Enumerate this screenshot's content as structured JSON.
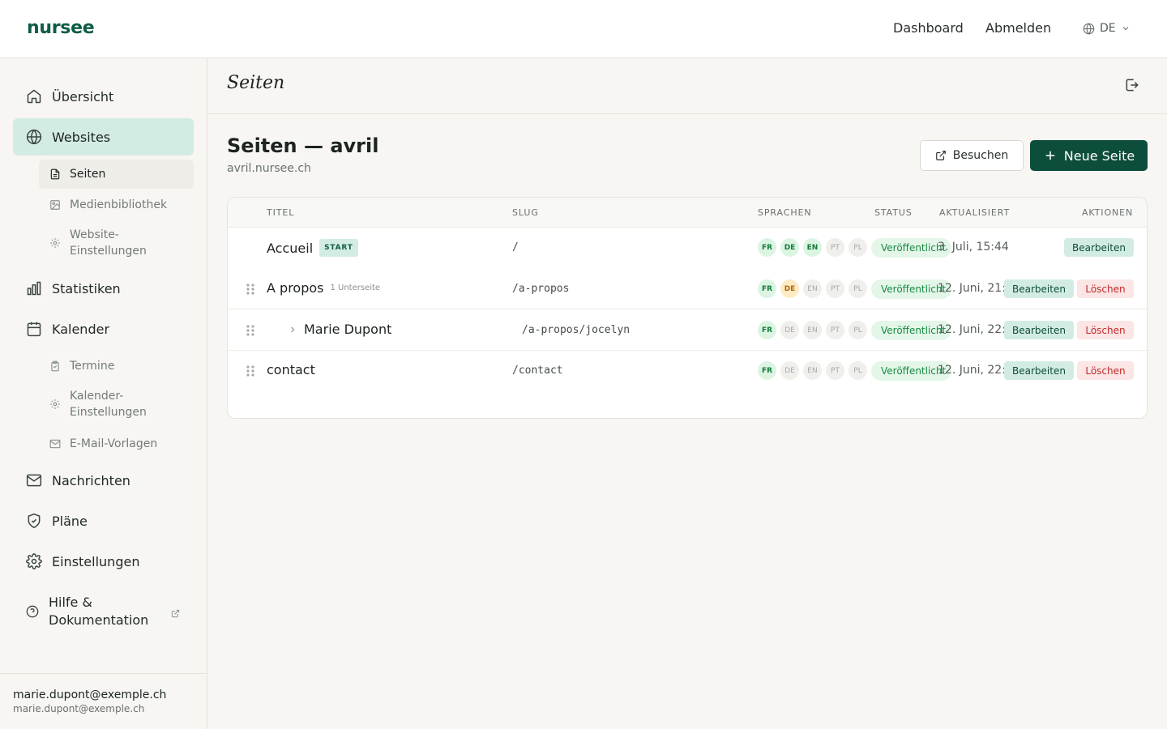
{
  "app": {
    "logo": "nursee"
  },
  "topnav": {
    "dashboard": "Dashboard",
    "logout": "Abmelden",
    "language": "DE"
  },
  "sidebar": {
    "items": [
      {
        "label": "Übersicht",
        "icon": "home-icon"
      },
      {
        "label": "Websites",
        "icon": "globe-icon",
        "active": true
      },
      {
        "label": "Statistiken",
        "icon": "bar-chart-icon"
      },
      {
        "label": "Kalender",
        "icon": "calendar-icon"
      },
      {
        "label": "Nachrichten",
        "icon": "mail-icon"
      },
      {
        "label": "Pläne",
        "icon": "shield-check-icon"
      },
      {
        "label": "Einstellungen",
        "icon": "gear-icon"
      },
      {
        "label": "Hilfe & Dokumentation",
        "icon": "help-circle-icon"
      }
    ],
    "website_sub": [
      {
        "label": "Seiten",
        "icon": "document-icon",
        "active": true
      },
      {
        "label": "Medienbibliothek",
        "icon": "image-icon"
      },
      {
        "label": "Website-Einstellungen",
        "icon": "gear-icon"
      }
    ],
    "calendar_sub": [
      {
        "label": "Termine",
        "icon": "clipboard-icon"
      },
      {
        "label": "Kalender-Einstellungen",
        "icon": "gear-icon"
      },
      {
        "label": "E-Mail-Vorlagen",
        "icon": "mail-icon"
      }
    ],
    "help_line1": "Hilfe &",
    "help_line2": "Dokumentation",
    "website_settings_line1": "Website-",
    "website_settings_line2": "Einstellungen",
    "calendar_settings_line1": "Kalender-",
    "calendar_settings_line2": "Einstellungen",
    "user_name": "marie.dupont@exemple.ch",
    "user_email": "marie.dupont@exemple.ch"
  },
  "page": {
    "header_title": "Seiten",
    "heading": "Seiten — avril",
    "domain": "avril.nursee.ch",
    "visit_button": "Besuchen",
    "new_page_button": "Neue Seite"
  },
  "table": {
    "columns": [
      "TITEL",
      "SLUG",
      "SPRACHEN",
      "STATUS",
      "AKTUALISIERT",
      "AKTIONEN"
    ],
    "rows": [
      {
        "title": "Accueil",
        "badge": "START",
        "subcount": "",
        "slug": "/",
        "langs": [
          [
            "FR",
            "g"
          ],
          [
            "DE",
            "g"
          ],
          [
            "EN",
            "g"
          ],
          [
            "PT",
            "n"
          ],
          [
            "PL",
            "n"
          ]
        ],
        "status": "Veröffentlicht",
        "updated": "3. Juli, 15:44",
        "edit": "Bearbeiten",
        "delete": ""
      },
      {
        "title": "A propos",
        "badge": "",
        "subcount": "1 Unterseite",
        "slug": "/a-propos",
        "langs": [
          [
            "FR",
            "g"
          ],
          [
            "DE",
            "y"
          ],
          [
            "EN",
            "n"
          ],
          [
            "PT",
            "n"
          ],
          [
            "PL",
            "n"
          ]
        ],
        "status": "Veröffentlicht",
        "updated": "12. Juni, 21:02",
        "edit": "Bearbeiten",
        "delete": "Löschen"
      },
      {
        "title": "Marie Dupont",
        "badge": "",
        "subcount": "",
        "slug": "/a-propos/jocelyn",
        "langs": [
          [
            "FR",
            "g"
          ],
          [
            "DE",
            "n"
          ],
          [
            "EN",
            "n"
          ],
          [
            "PT",
            "n"
          ],
          [
            "PL",
            "n"
          ]
        ],
        "status": "Veröffentlicht",
        "updated": "12. Juni, 22:31",
        "edit": "Bearbeiten",
        "delete": "Löschen"
      },
      {
        "title": "contact",
        "badge": "",
        "subcount": "",
        "slug": "/contact",
        "langs": [
          [
            "FR",
            "g"
          ],
          [
            "DE",
            "n"
          ],
          [
            "EN",
            "n"
          ],
          [
            "PT",
            "n"
          ],
          [
            "PL",
            "n"
          ]
        ],
        "status": "Veröffentlicht",
        "updated": "12. Juni, 22:22",
        "edit": "Bearbeiten",
        "delete": "Löschen"
      }
    ]
  },
  "colors": {
    "brand": "#0d5c47",
    "primary_button": "#0d4d3c",
    "active_nav": "#d3ece3",
    "published": "#1a8a45",
    "danger": "#c22a2a"
  }
}
